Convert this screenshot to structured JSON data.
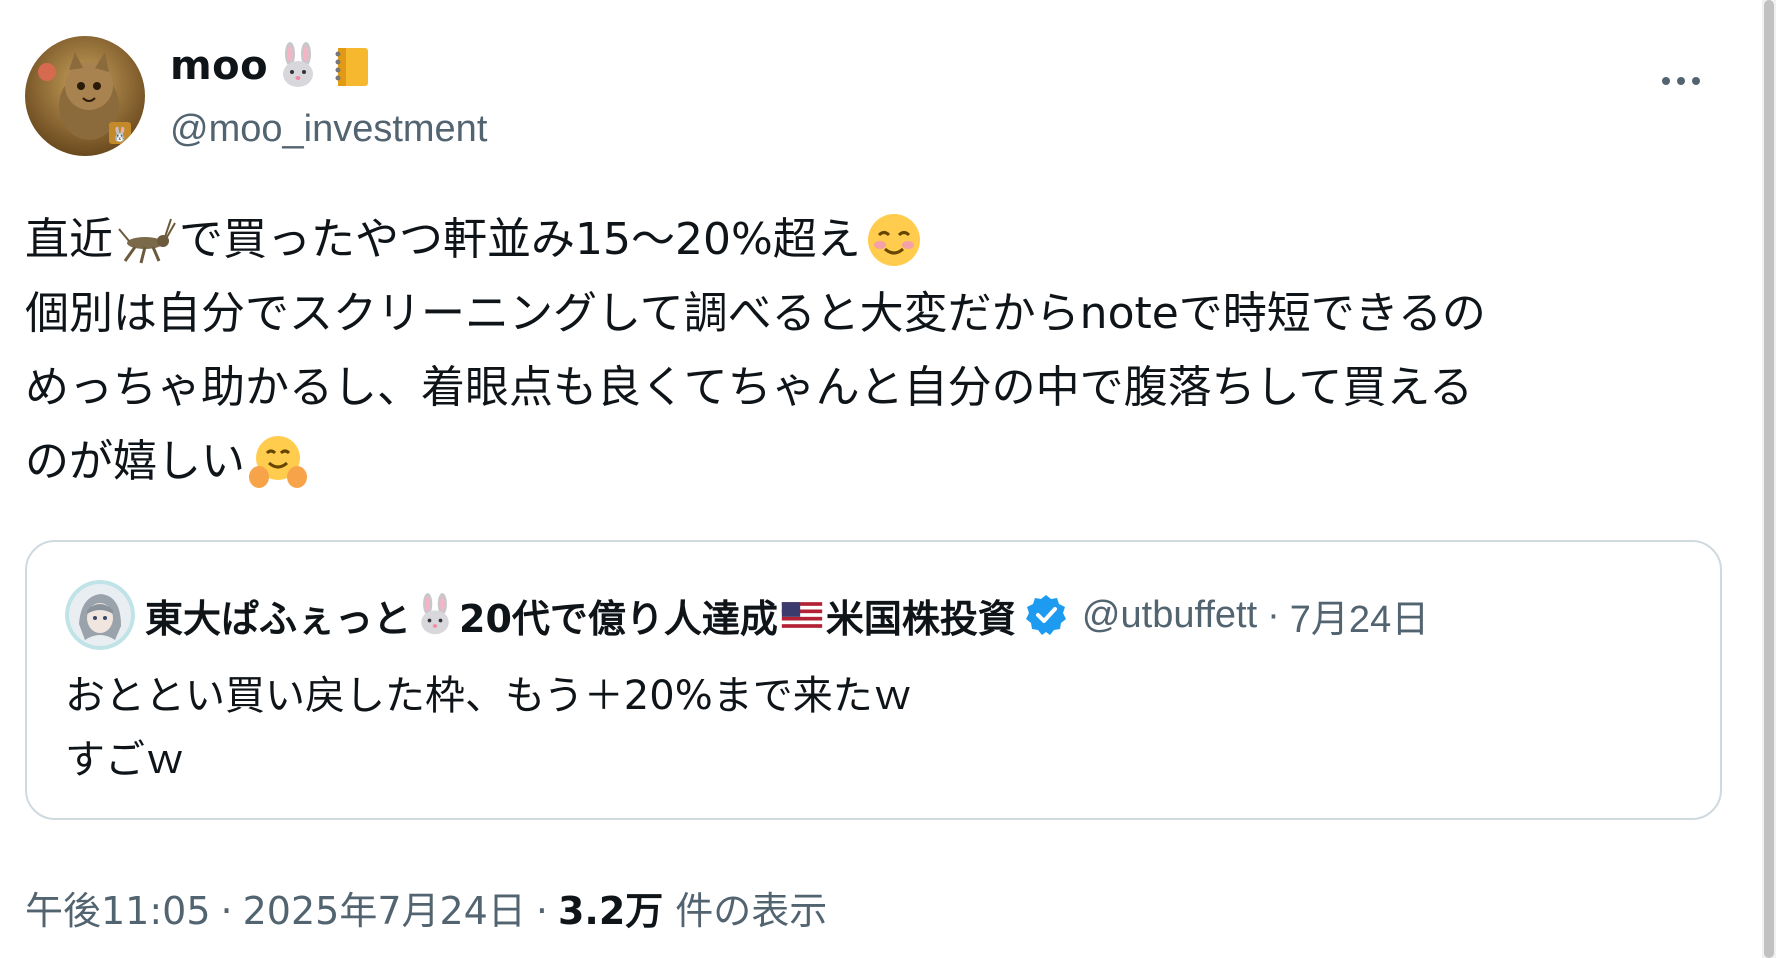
{
  "author": {
    "display_name": "moo",
    "handle": "@moo_investment",
    "name_emojis": [
      "rabbit-face-icon",
      "notebook-icon"
    ]
  },
  "tweet": {
    "lines": [
      {
        "before": "直近",
        "emoji": "cricket-icon",
        "middle": "で買ったやつ軒並み15〜20%超え",
        "emoji2": "smiling-face-icon"
      },
      {
        "text": "個別は自分でスクリーニングして調べると大変だからnoteで時短できるの"
      },
      {
        "text": "めっちゃ助かるし、着眼点も良くてちゃんと自分の中で腹落ちして買える"
      },
      {
        "text": "のが嬉しい",
        "emoji": "hugging-face-icon"
      }
    ]
  },
  "quote": {
    "name_part1": "東大ぱふぇっと",
    "name_part2": "20代で億り人達成",
    "name_part3": "米国株投資",
    "handle": "@utbuffett",
    "dot": "·",
    "date": "7月24日",
    "text_line1": "おととい買い戻した枠、もう＋20%まで来たｗ",
    "text_line2": "すごｗ"
  },
  "footer": {
    "time": "午後11:05",
    "sep1": "·",
    "date": "2025年7月24日",
    "sep2": "·",
    "views_count": "3.2万",
    "views_label": "件の表示"
  },
  "colors": {
    "text_primary": "#0f1419",
    "text_secondary": "#536471",
    "border": "#cfd9de",
    "verified": "#1d9bf0"
  }
}
